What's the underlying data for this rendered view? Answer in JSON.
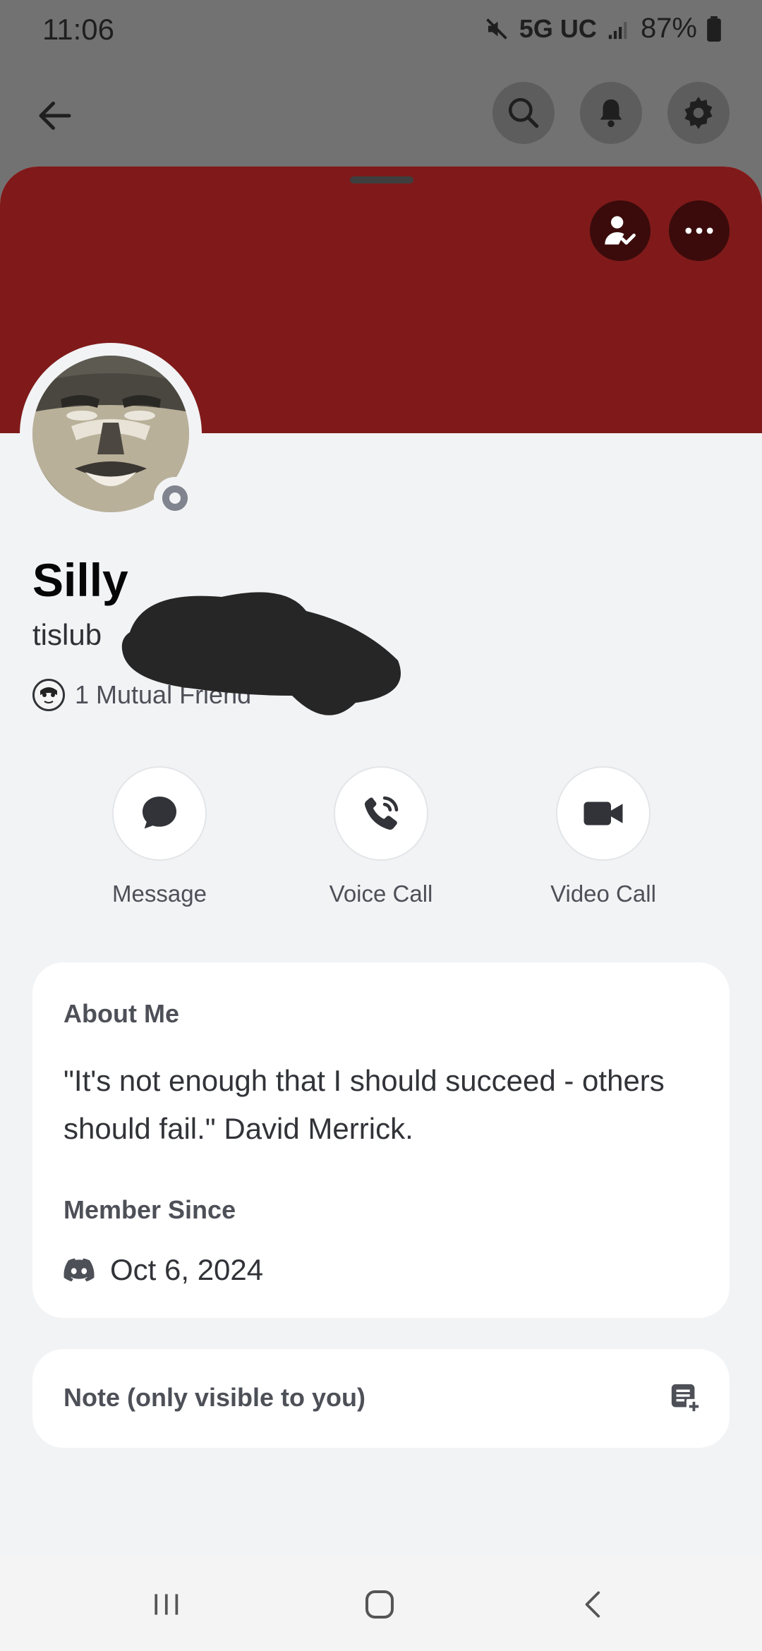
{
  "status_bar": {
    "time": "11:06",
    "network": "5G UC",
    "battery": "87%"
  },
  "header": {
    "back_icon": "arrow-left-icon",
    "actions": [
      "search-icon",
      "bell-icon",
      "gear-icon"
    ]
  },
  "profile": {
    "banner_color": "#801a1a",
    "display_name": "Silly",
    "username": "tislub",
    "mutual_friends": "1 Mutual Friend",
    "status": "offline",
    "status_color": "#80848e"
  },
  "quick_actions": [
    {
      "label": "Message",
      "icon": "chat-bubble-icon"
    },
    {
      "label": "Voice Call",
      "icon": "phone-icon"
    },
    {
      "label": "Video Call",
      "icon": "video-camera-icon"
    }
  ],
  "about": {
    "title": "About Me",
    "text": "\"It's not enough that I should succeed - others should fail.\" David Merrick.",
    "member_since_title": "Member Since",
    "member_since_date": "Oct 6, 2024"
  },
  "note": {
    "label": "Note (only visible to you)"
  },
  "colors": {
    "background": "#f2f3f5",
    "card": "#ffffff",
    "dim_overlay": "#727272"
  }
}
